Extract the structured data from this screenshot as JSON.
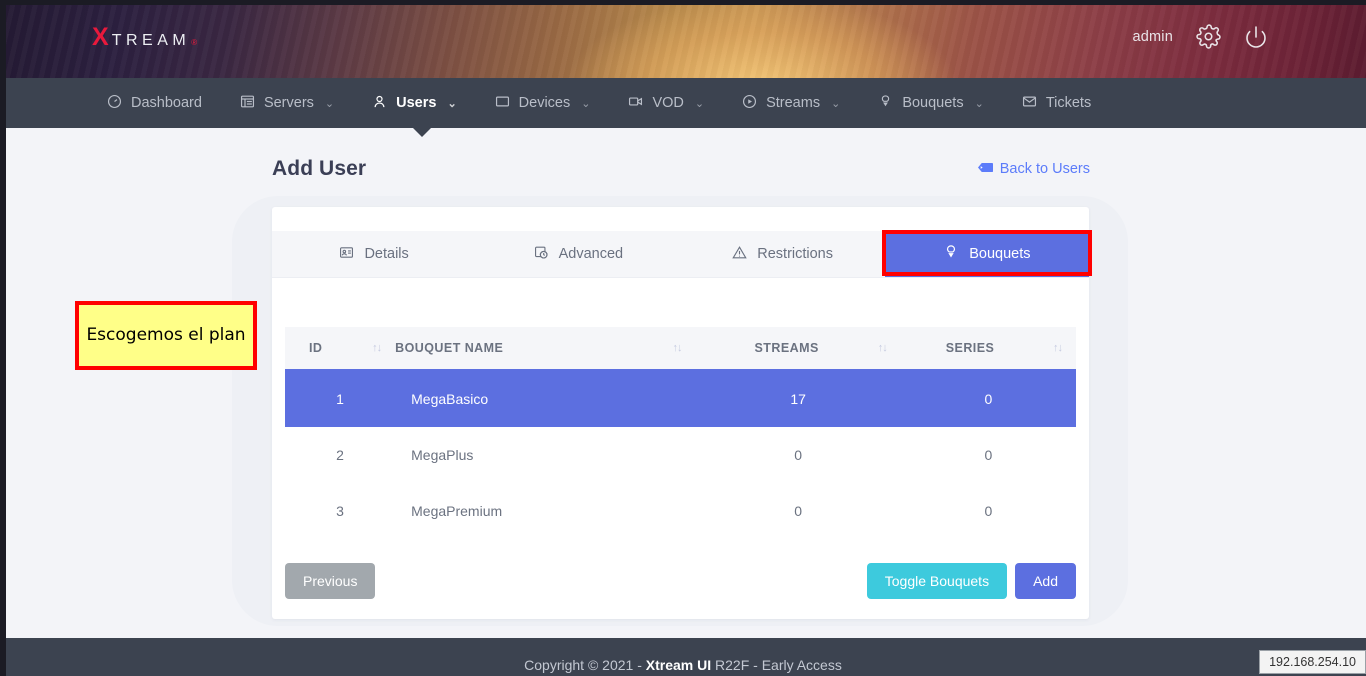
{
  "header": {
    "logo_x": "X",
    "logo_rest": "TREAM",
    "logo_sup": "®",
    "admin_label": "admin",
    "gear_icon": "gear-icon",
    "power_icon": "power-icon"
  },
  "nav": {
    "items": [
      {
        "label": "Dashboard",
        "icon": "dashboard-icon",
        "caret": "",
        "active": false
      },
      {
        "label": "Servers",
        "icon": "servers-icon",
        "caret": "⌄",
        "active": false
      },
      {
        "label": "Users",
        "icon": "user-icon",
        "caret": "⌄",
        "active": true
      },
      {
        "label": "Devices",
        "icon": "device-icon",
        "caret": "⌄",
        "active": false
      },
      {
        "label": "VOD",
        "icon": "video-icon",
        "caret": "⌄",
        "active": false
      },
      {
        "label": "Streams",
        "icon": "play-circle-icon",
        "caret": "⌄",
        "active": false
      },
      {
        "label": "Bouquets",
        "icon": "bouquet-icon",
        "caret": "⌄",
        "active": false
      },
      {
        "label": "Tickets",
        "icon": "mail-icon",
        "caret": "",
        "active": false
      }
    ]
  },
  "page": {
    "title": "Add User",
    "back_link": "Back to Users",
    "back_icon": "back-tag-icon"
  },
  "tabs": [
    {
      "label": "Details",
      "icon": "id-card-icon",
      "active": false
    },
    {
      "label": "Advanced",
      "icon": "advanced-icon",
      "active": false
    },
    {
      "label": "Restrictions",
      "icon": "warning-triangle-icon",
      "active": false
    },
    {
      "label": "Bouquets",
      "icon": "bouquet-icon",
      "active": true
    }
  ],
  "table": {
    "columns": [
      {
        "key": "id",
        "label": "ID",
        "sort": "↑↓"
      },
      {
        "key": "name",
        "label": "BOUQUET NAME",
        "sort": "↑↓"
      },
      {
        "key": "streams",
        "label": "STREAMS",
        "sort": "↑↓"
      },
      {
        "key": "series",
        "label": "SERIES",
        "sort": "↑↓"
      }
    ],
    "rows": [
      {
        "id": "1",
        "name": "MegaBasico",
        "streams": "17",
        "series": "0",
        "selected": true
      },
      {
        "id": "2",
        "name": "MegaPlus",
        "streams": "0",
        "series": "0",
        "selected": false
      },
      {
        "id": "3",
        "name": "MegaPremium",
        "streams": "0",
        "series": "0",
        "selected": false
      }
    ]
  },
  "actions": {
    "previous": "Previous",
    "toggle_bouquets": "Toggle Bouquets",
    "add": "Add"
  },
  "annotation": {
    "text": "Escogemos el plan"
  },
  "footer": {
    "prefix": "Copyright © 2021 - ",
    "brand": "Xtream UI",
    "suffix": " R22F - Early Access"
  },
  "status": {
    "ip": "192.168.254.10"
  },
  "colors": {
    "accent_blue": "#5c6fe0",
    "cyan": "#3dcadd",
    "gray_btn": "#a2a8ad",
    "nav_bg": "#3c4350",
    "link_blue": "#5c7cfa",
    "annotation_bg": "#ffff88",
    "annotation_border": "#ff0000",
    "logo_red": "#e8193c"
  }
}
